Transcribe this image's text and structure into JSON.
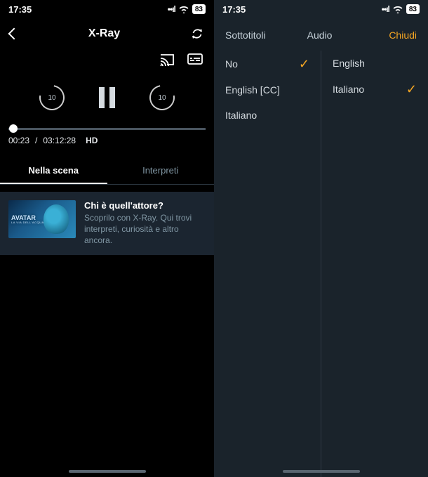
{
  "status": {
    "time": "17:35",
    "battery": "83"
  },
  "left": {
    "header": {
      "title": "X-Ray"
    },
    "player": {
      "skip_seconds": "10",
      "time_current": "00:23",
      "time_total": "03:12:28",
      "quality": "HD"
    },
    "tabs": {
      "scene": "Nella scena",
      "cast": "Interpreti"
    },
    "card": {
      "thumb_title": "AVATAR",
      "thumb_sub": "LA VIA DELL'ACQUA",
      "title": "Chi è quell'attore?",
      "desc": "Scoprilo con X-Ray. Qui trovi interpreti, curiosità e altro ancora."
    }
  },
  "right": {
    "header": {
      "subtitles": "Sottotitoli",
      "audio": "Audio",
      "close": "Chiudi"
    },
    "subtitles": {
      "none": "No",
      "english_cc": "English [CC]",
      "italian": "Italiano",
      "selected": "none"
    },
    "audio": {
      "english": "English",
      "italian": "Italiano",
      "selected": "italian"
    }
  }
}
